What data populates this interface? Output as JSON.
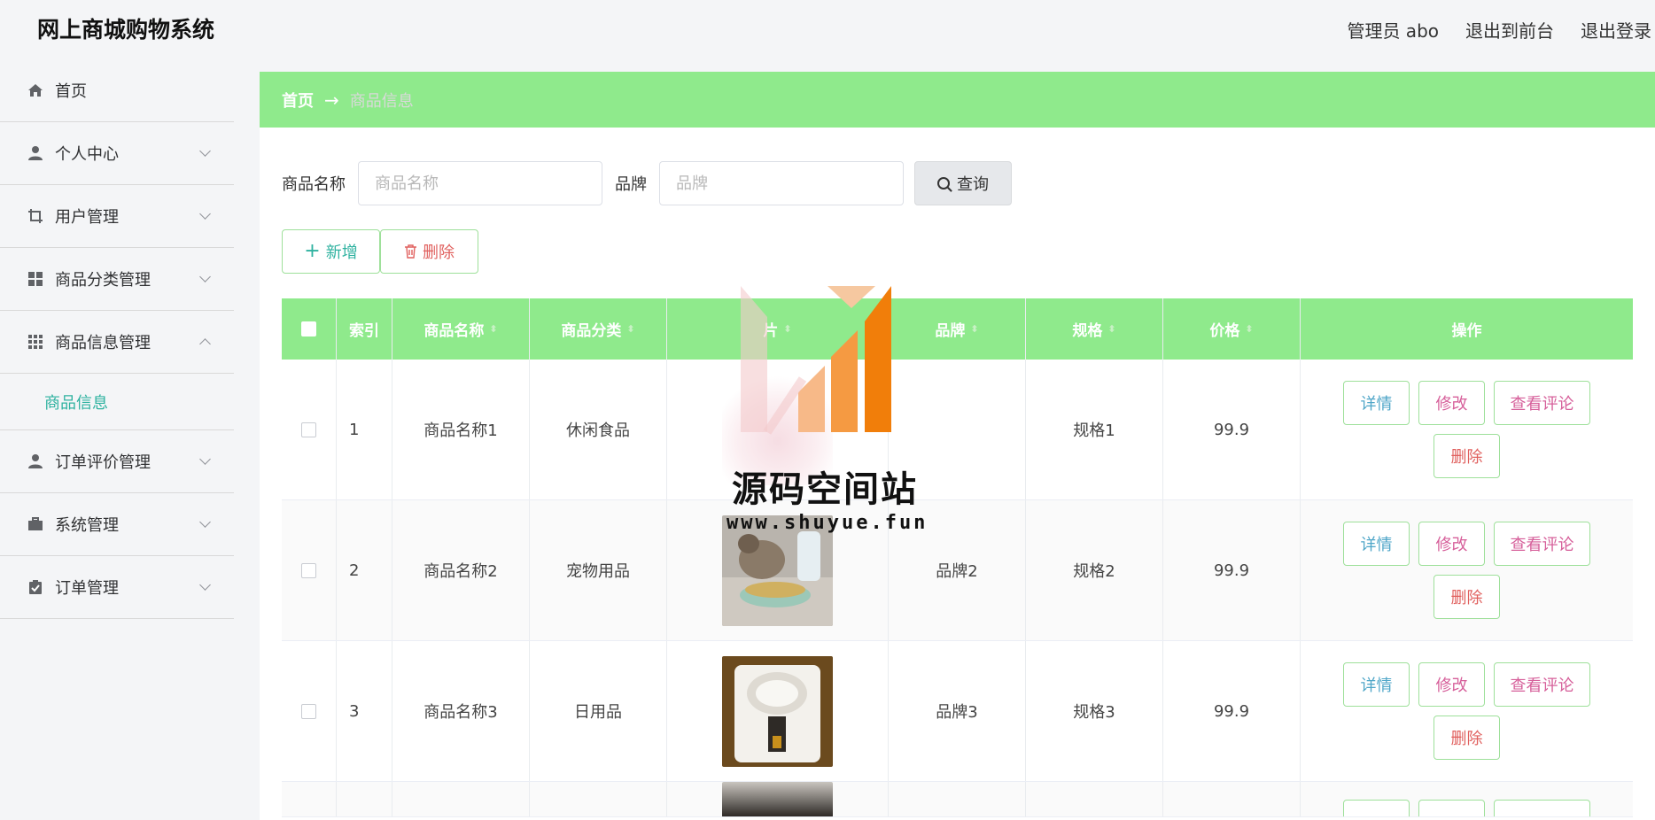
{
  "header": {
    "app_title": "网上商城购物系统",
    "admin_label": "管理员 abo",
    "exit_front": "退出到前台",
    "logout": "退出登录"
  },
  "sidebar": {
    "items": [
      {
        "label": "首页",
        "icon": "home-icon"
      },
      {
        "label": "个人中心",
        "icon": "user-icon"
      },
      {
        "label": "用户管理",
        "icon": "crop-icon"
      },
      {
        "label": "商品分类管理",
        "icon": "grid-icon"
      },
      {
        "label": "商品信息管理",
        "icon": "apps-icon"
      },
      {
        "label": "订单评价管理",
        "icon": "user-icon"
      },
      {
        "label": "系统管理",
        "icon": "briefcase-icon"
      },
      {
        "label": "订单管理",
        "icon": "clipboard-icon"
      }
    ],
    "active_sub": "商品信息"
  },
  "breadcrumb": {
    "home": "首页",
    "arrow": "→",
    "current": "商品信息"
  },
  "search": {
    "name_label": "商品名称",
    "name_placeholder": "商品名称",
    "brand_label": "品牌",
    "brand_placeholder": "品牌",
    "query_label": "查询"
  },
  "actions": {
    "add": "新增",
    "delete": "删除",
    "add_symbol": "+"
  },
  "table": {
    "headers": {
      "index": "索引",
      "name": "商品名称",
      "category": "商品分类",
      "image": "片",
      "brand": "品牌",
      "spec": "规格",
      "price": "价格",
      "ops": "操作"
    },
    "rows": [
      {
        "index": "1",
        "name": "商品名称1",
        "category": "休闲食品",
        "brand": "",
        "spec": "规格1",
        "price": "99.9"
      },
      {
        "index": "2",
        "name": "商品名称2",
        "category": "宠物用品",
        "brand": "品牌2",
        "spec": "规格2",
        "price": "99.9"
      },
      {
        "index": "3",
        "name": "商品名称3",
        "category": "日用品",
        "brand": "品牌3",
        "spec": "规格3",
        "price": "99.9"
      }
    ],
    "op_labels": {
      "detail": "详情",
      "edit": "修改",
      "review": "查看评论",
      "delete": "删除"
    }
  },
  "watermark": {
    "cn": "源码空间站",
    "url": "www.shuyue.fun"
  },
  "colors": {
    "accent_green": "#8fea8c",
    "teal": "#2fb2a0",
    "danger": "#e0605e",
    "pink": "#d65f9a",
    "info": "#4fa6c8"
  }
}
